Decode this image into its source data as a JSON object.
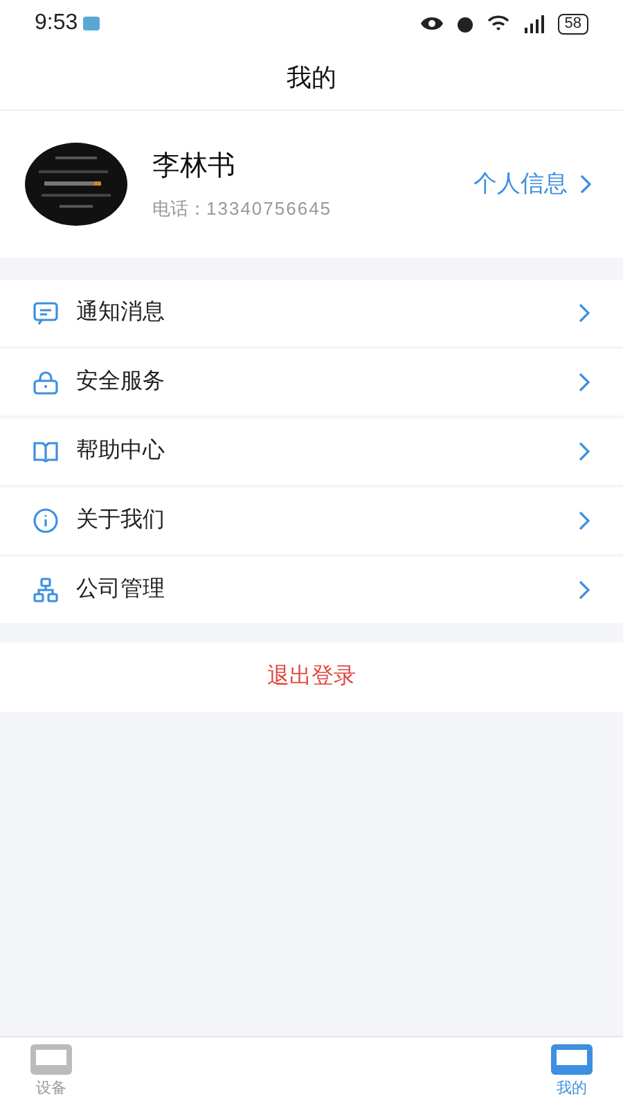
{
  "status_bar": {
    "time": "9:53",
    "battery": "58"
  },
  "header": {
    "title": "我的"
  },
  "profile": {
    "name": "李林书",
    "phone_label": "电话：",
    "phone": "13340756645",
    "link": "个人信息"
  },
  "menu": [
    {
      "kind": "message",
      "label": "通知消息"
    },
    {
      "kind": "lock",
      "label": "安全服务"
    },
    {
      "kind": "book",
      "label": "帮助中心"
    },
    {
      "kind": "info",
      "label": "关于我们"
    },
    {
      "kind": "org",
      "label": "公司管理"
    }
  ],
  "logout": "退出登录",
  "tab_bar": [
    {
      "label": "设备",
      "selected": false
    },
    {
      "label": "我的",
      "selected": true
    }
  ]
}
